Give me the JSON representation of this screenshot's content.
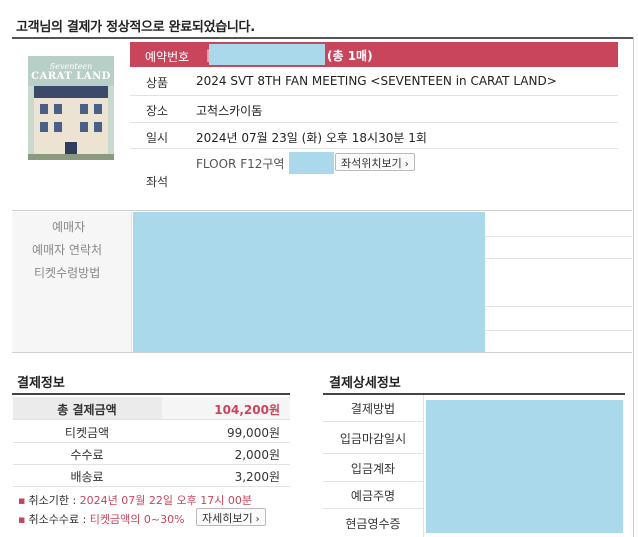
{
  "page": {
    "title": "고객님의 결제가 정상적으로 완료되었습니다."
  },
  "booking": {
    "number_label": "예약번호",
    "separator": "|",
    "ticket_count": "(총 1매)",
    "rows": [
      {
        "label": "상품",
        "value": "2024 SVT 8TH FAN MEETING <SEVENTEEN in CARAT LAND>"
      },
      {
        "label": "장소",
        "value": "고척스카이돔"
      },
      {
        "label": "일시",
        "value": "2024년 07월 23일 (화) 오후 18시30분 1회"
      }
    ],
    "seat": {
      "label": "좌석",
      "value": "FLOOR F12구역",
      "view_button": "좌석위치보기"
    }
  },
  "poster": {
    "subtitle": "Seventeen",
    "title": "CARAT LAND"
  },
  "buyer": {
    "labels": [
      "예매자",
      "예매자 연락처",
      "티켓수령방법"
    ]
  },
  "payment_info": {
    "title": "결제정보",
    "rows": [
      {
        "label": "총 결제금액",
        "value": "104,200원"
      },
      {
        "label": "티켓금액",
        "value": "99,000원"
      },
      {
        "label": "수수료",
        "value": "2,000원"
      },
      {
        "label": "배송료",
        "value": "3,200원"
      }
    ],
    "notices": {
      "cancel_deadline_label": "취소기한 :",
      "cancel_deadline_value": "2024년 07월 22일 오후 17시 00분",
      "cancel_fee_label": "취소수수료 :",
      "cancel_fee_value": "티켓금액의 0~30%",
      "detail_button": "자세히보기"
    }
  },
  "payment_detail": {
    "title": "결제상세정보",
    "labels": [
      "결제방법",
      "입금마감일시",
      "입금계좌",
      "예금주명",
      "현금영수증"
    ]
  },
  "colors": {
    "accent": "#c9455c",
    "redacted": "#a9d9ea"
  }
}
